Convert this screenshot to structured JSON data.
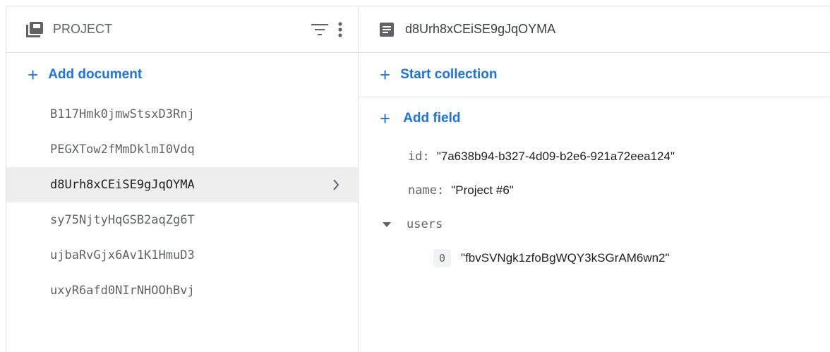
{
  "left_panel": {
    "title": "PROJECT",
    "add_label": "Add document",
    "documents": [
      {
        "id": "B117Hmk0jmwStsxD3Rnj"
      },
      {
        "id": "PEGXTow2fMmDklmI0Vdq"
      },
      {
        "id": "d8Urh8xCEiSE9gJqOYMA"
      },
      {
        "id": "sy75NjtyHqGSB2aqZg6T"
      },
      {
        "id": "ujbaRvGjx6Av1K1HmuD3"
      },
      {
        "id": "uxyR6afd0NIrNHOOhBvj"
      }
    ],
    "selected_index": 2,
    "icons": {
      "header": "collection-icon",
      "filter": "filter-icon",
      "more": "more-vert-icon",
      "chevron": "chevron-right-icon"
    }
  },
  "right_panel": {
    "title": "d8Urh8xCEiSE9gJqOYMA",
    "start_collection_label": "Start collection",
    "add_field_label": "Add field",
    "fields": [
      {
        "key": "id",
        "value": "\"7a638b94-b327-4d09-b2e6-921a72eea124\""
      },
      {
        "key": "name",
        "value": "\"Project #6\""
      }
    ],
    "array_field": {
      "key": "users",
      "items": [
        {
          "index": "0",
          "value": "\"fbvSVNgk1zfoBgWQY3kSGrAM6wn2\""
        }
      ]
    },
    "icons": {
      "header": "document-icon",
      "caret": "caret-down-icon"
    }
  },
  "colors": {
    "accent": "#1a73e8",
    "selected_bg": "#eeeeee",
    "divider": "#e0e0e0"
  }
}
